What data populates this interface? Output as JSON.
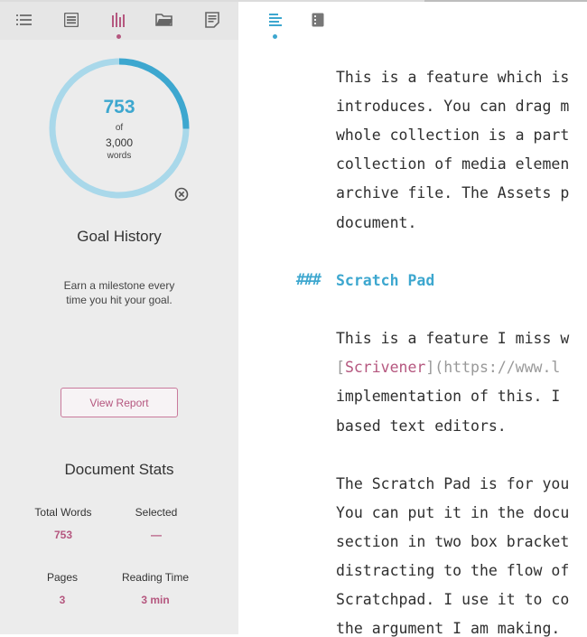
{
  "sidebar": {
    "tabs": [
      {
        "name": "outline-icon"
      },
      {
        "name": "library-icon"
      },
      {
        "name": "goals-icon",
        "active": true
      },
      {
        "name": "folder-icon"
      },
      {
        "name": "notes-icon"
      }
    ],
    "goal": {
      "count": "753",
      "of_label": "of",
      "target": "3,000",
      "unit": "words",
      "progress": 0.251,
      "history_title": "Goal History",
      "history_desc_line1": "Earn a milestone every",
      "history_desc_line2": "time you hit your goal.",
      "report_button": "View Report"
    },
    "stats": {
      "title": "Document Stats",
      "total_words_label": "Total Words",
      "total_words_value": "753",
      "selected_label": "Selected",
      "selected_value": "—",
      "pages_label": "Pages",
      "pages_value": "3",
      "reading_time_label": "Reading Time",
      "reading_time_value": "3 min"
    }
  },
  "editor": {
    "tabs": [
      {
        "name": "text-view-icon",
        "active": true
      },
      {
        "name": "document-panel-icon"
      }
    ],
    "para1": [
      "This is a feature which is",
      "introduces. You can drag m",
      "whole collection is a part",
      "collection of media elemen",
      "archive file. The Assets p",
      "document."
    ],
    "heading_mark": "###",
    "heading_text": "Scratch Pad",
    "para2_line1": "This is a feature I miss w",
    "para2_line2_open": "[",
    "para2_line2_link": "Scrivener",
    "para2_line2_close": "]",
    "para2_line2_url": "(https://www.l",
    "para2_line3": "implementation of this. I",
    "para2_line4": "based text editors.",
    "para3": [
      "The Scratch Pad is for you",
      "You can put it in the docu",
      "section in two box bracket",
      "distracting to the flow of",
      "Scratchpad. I use it to co",
      "the argument I am making."
    ]
  },
  "colors": {
    "accent_blue": "#3da7cf",
    "accent_pink": "#b5577f",
    "ring_track": "#a9d8ea"
  }
}
